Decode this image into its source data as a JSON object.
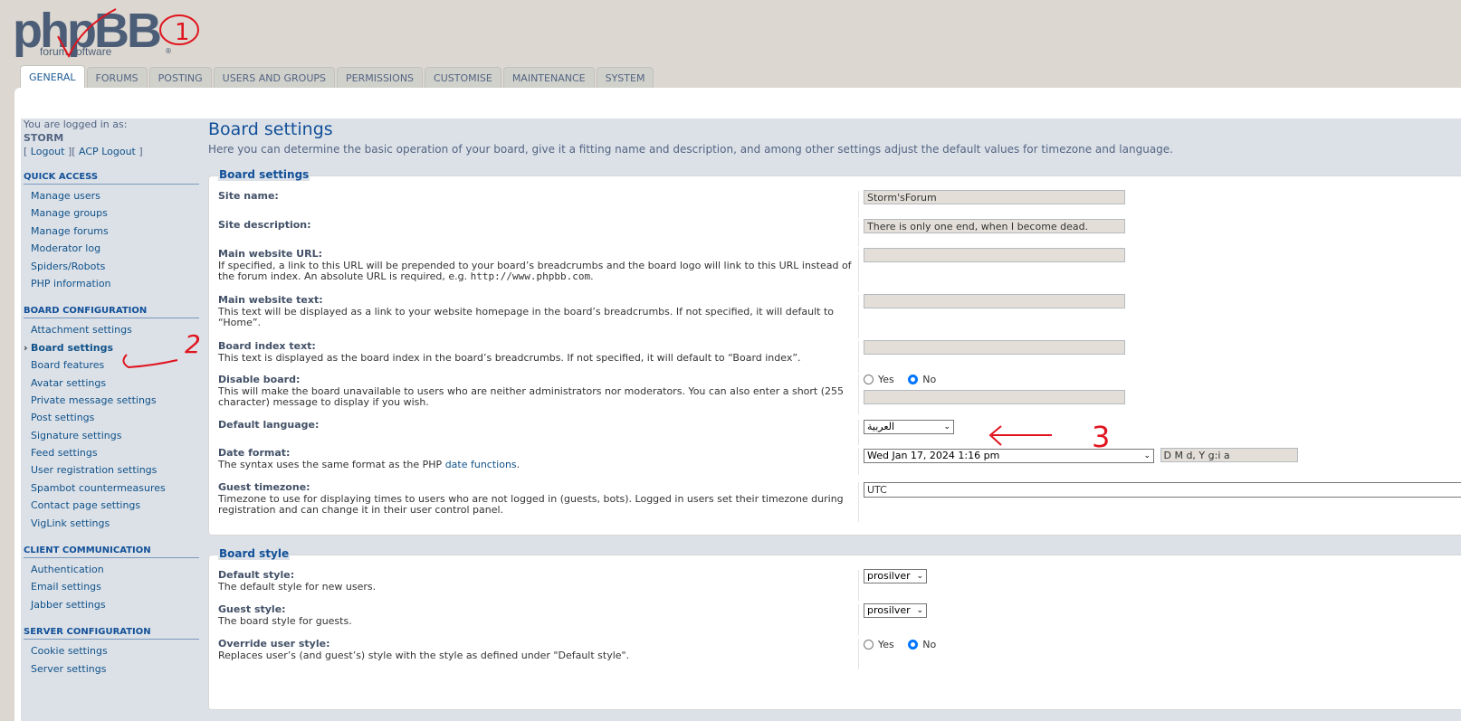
{
  "logo": {
    "word_ph": "php",
    "word_bb": "BB",
    "tagline": "forum  software",
    "reg": "®"
  },
  "tabs": [
    {
      "label": "GENERAL",
      "active": true
    },
    {
      "label": "FORUMS"
    },
    {
      "label": "POSTING"
    },
    {
      "label": "USERS AND GROUPS"
    },
    {
      "label": "PERMISSIONS"
    },
    {
      "label": "CUSTOMISE"
    },
    {
      "label": "MAINTENANCE"
    },
    {
      "label": "SYSTEM"
    }
  ],
  "login": {
    "logged_as": "You are logged in as:",
    "username": "STORM",
    "bracket_open": "[ ",
    "logout": "Logout",
    "sep": " ][ ",
    "acp_logout": "ACP Logout",
    "bracket_close": " ]"
  },
  "menu": {
    "quick_access": {
      "title": "QUICK ACCESS",
      "items": [
        "Manage users",
        "Manage groups",
        "Manage forums",
        "Moderator log",
        "Spiders/Robots",
        "PHP information"
      ]
    },
    "board_config": {
      "title": "BOARD CONFIGURATION",
      "items": [
        "Attachment settings",
        "Board settings",
        "Board features",
        "Avatar settings",
        "Private message settings",
        "Post settings",
        "Signature settings",
        "Feed settings",
        "User registration settings",
        "Spambot countermeasures",
        "Contact page settings",
        "VigLink settings"
      ]
    },
    "client_comm": {
      "title": "CLIENT COMMUNICATION",
      "items": [
        "Authentication",
        "Email settings",
        "Jabber settings"
      ]
    },
    "server_config": {
      "title": "SERVER CONFIGURATION",
      "items": [
        "Cookie settings",
        "Server settings"
      ]
    }
  },
  "page": {
    "title": "Board settings",
    "intro": "Here you can determine the basic operation of your board, give it a fitting name and description, and among other settings adjust the default values for timezone and language."
  },
  "board_settings": {
    "legend": "Board settings",
    "site_name": {
      "label": "Site name:",
      "value": "Storm'sForum"
    },
    "site_desc": {
      "label": "Site description:",
      "value": "There is only one end, when I become dead."
    },
    "site_home_url": {
      "label": "Main website URL:",
      "explain": "If specified, a link to this URL will be prepended to your board’s breadcrumbs and the board logo will link to this URL instead of the forum index. An absolute URL is required, e.g. ",
      "example": "http://www.phpbb.com",
      "explain_end": ".",
      "value": ""
    },
    "site_home_text": {
      "label": "Main website text:",
      "explain": "This text will be displayed as a link to your website homepage in the board’s breadcrumbs. If not specified, it will default to “Home”.",
      "value": ""
    },
    "board_index_text": {
      "label": "Board index text:",
      "explain": "This text is displayed as the board index in the board’s breadcrumbs. If not specified, it will default to “Board index”.",
      "value": ""
    },
    "disable_board": {
      "label": "Disable board:",
      "explain": "This will make the board unavailable to users who are neither administrators nor moderators. You can also enter a short (255 character) message to display if you wish.",
      "yes": "Yes",
      "no": "No",
      "selected": "No",
      "message": ""
    },
    "default_lang": {
      "label": "Default language:",
      "value": "العربية"
    },
    "date_format": {
      "label": "Date format:",
      "explain": "The syntax uses the same format as the PHP ",
      "link": "date functions",
      "explain_end": ".",
      "selected": "Wed Jan 17, 2024 1:16 pm",
      "custom": "D M d, Y g:i a"
    },
    "guest_tz": {
      "label": "Guest timezone:",
      "explain": "Timezone to use for displaying times to users who are not logged in (guests, bots). Logged in users set their timezone during registration and can change it in their user control panel.",
      "value": "UTC"
    }
  },
  "board_style": {
    "legend": "Board style",
    "default_style": {
      "label": "Default style:",
      "explain": "The default style for new users.",
      "value": "prosilver"
    },
    "guest_style": {
      "label": "Guest style:",
      "explain": "The board style for guests.",
      "value": "prosilver"
    },
    "override_style": {
      "label": "Override user style:",
      "explain": "Replaces user’s (and guest’s) style with the style as defined under \"Default style\".",
      "yes": "Yes",
      "no": "No",
      "selected": "No"
    }
  },
  "annotations": {
    "mark1": "1",
    "mark2": "2",
    "mark3": "3",
    "color": "#e0141e"
  }
}
